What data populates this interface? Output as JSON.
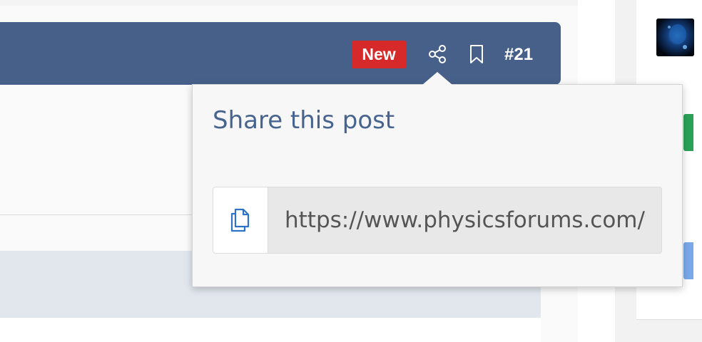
{
  "post": {
    "badge": "New",
    "number": "#21",
    "icons": {
      "share": "share-icon",
      "bookmark": "bookmark-icon"
    }
  },
  "share_popup": {
    "title": "Share this post",
    "url": "https://www.physicsforums.com/threads/",
    "copy_icon": "copy-icon"
  },
  "colors": {
    "header": "#46608a",
    "new_badge": "#d62a2a",
    "title_text": "#47648f",
    "copy_icon": "#2f73c7"
  }
}
